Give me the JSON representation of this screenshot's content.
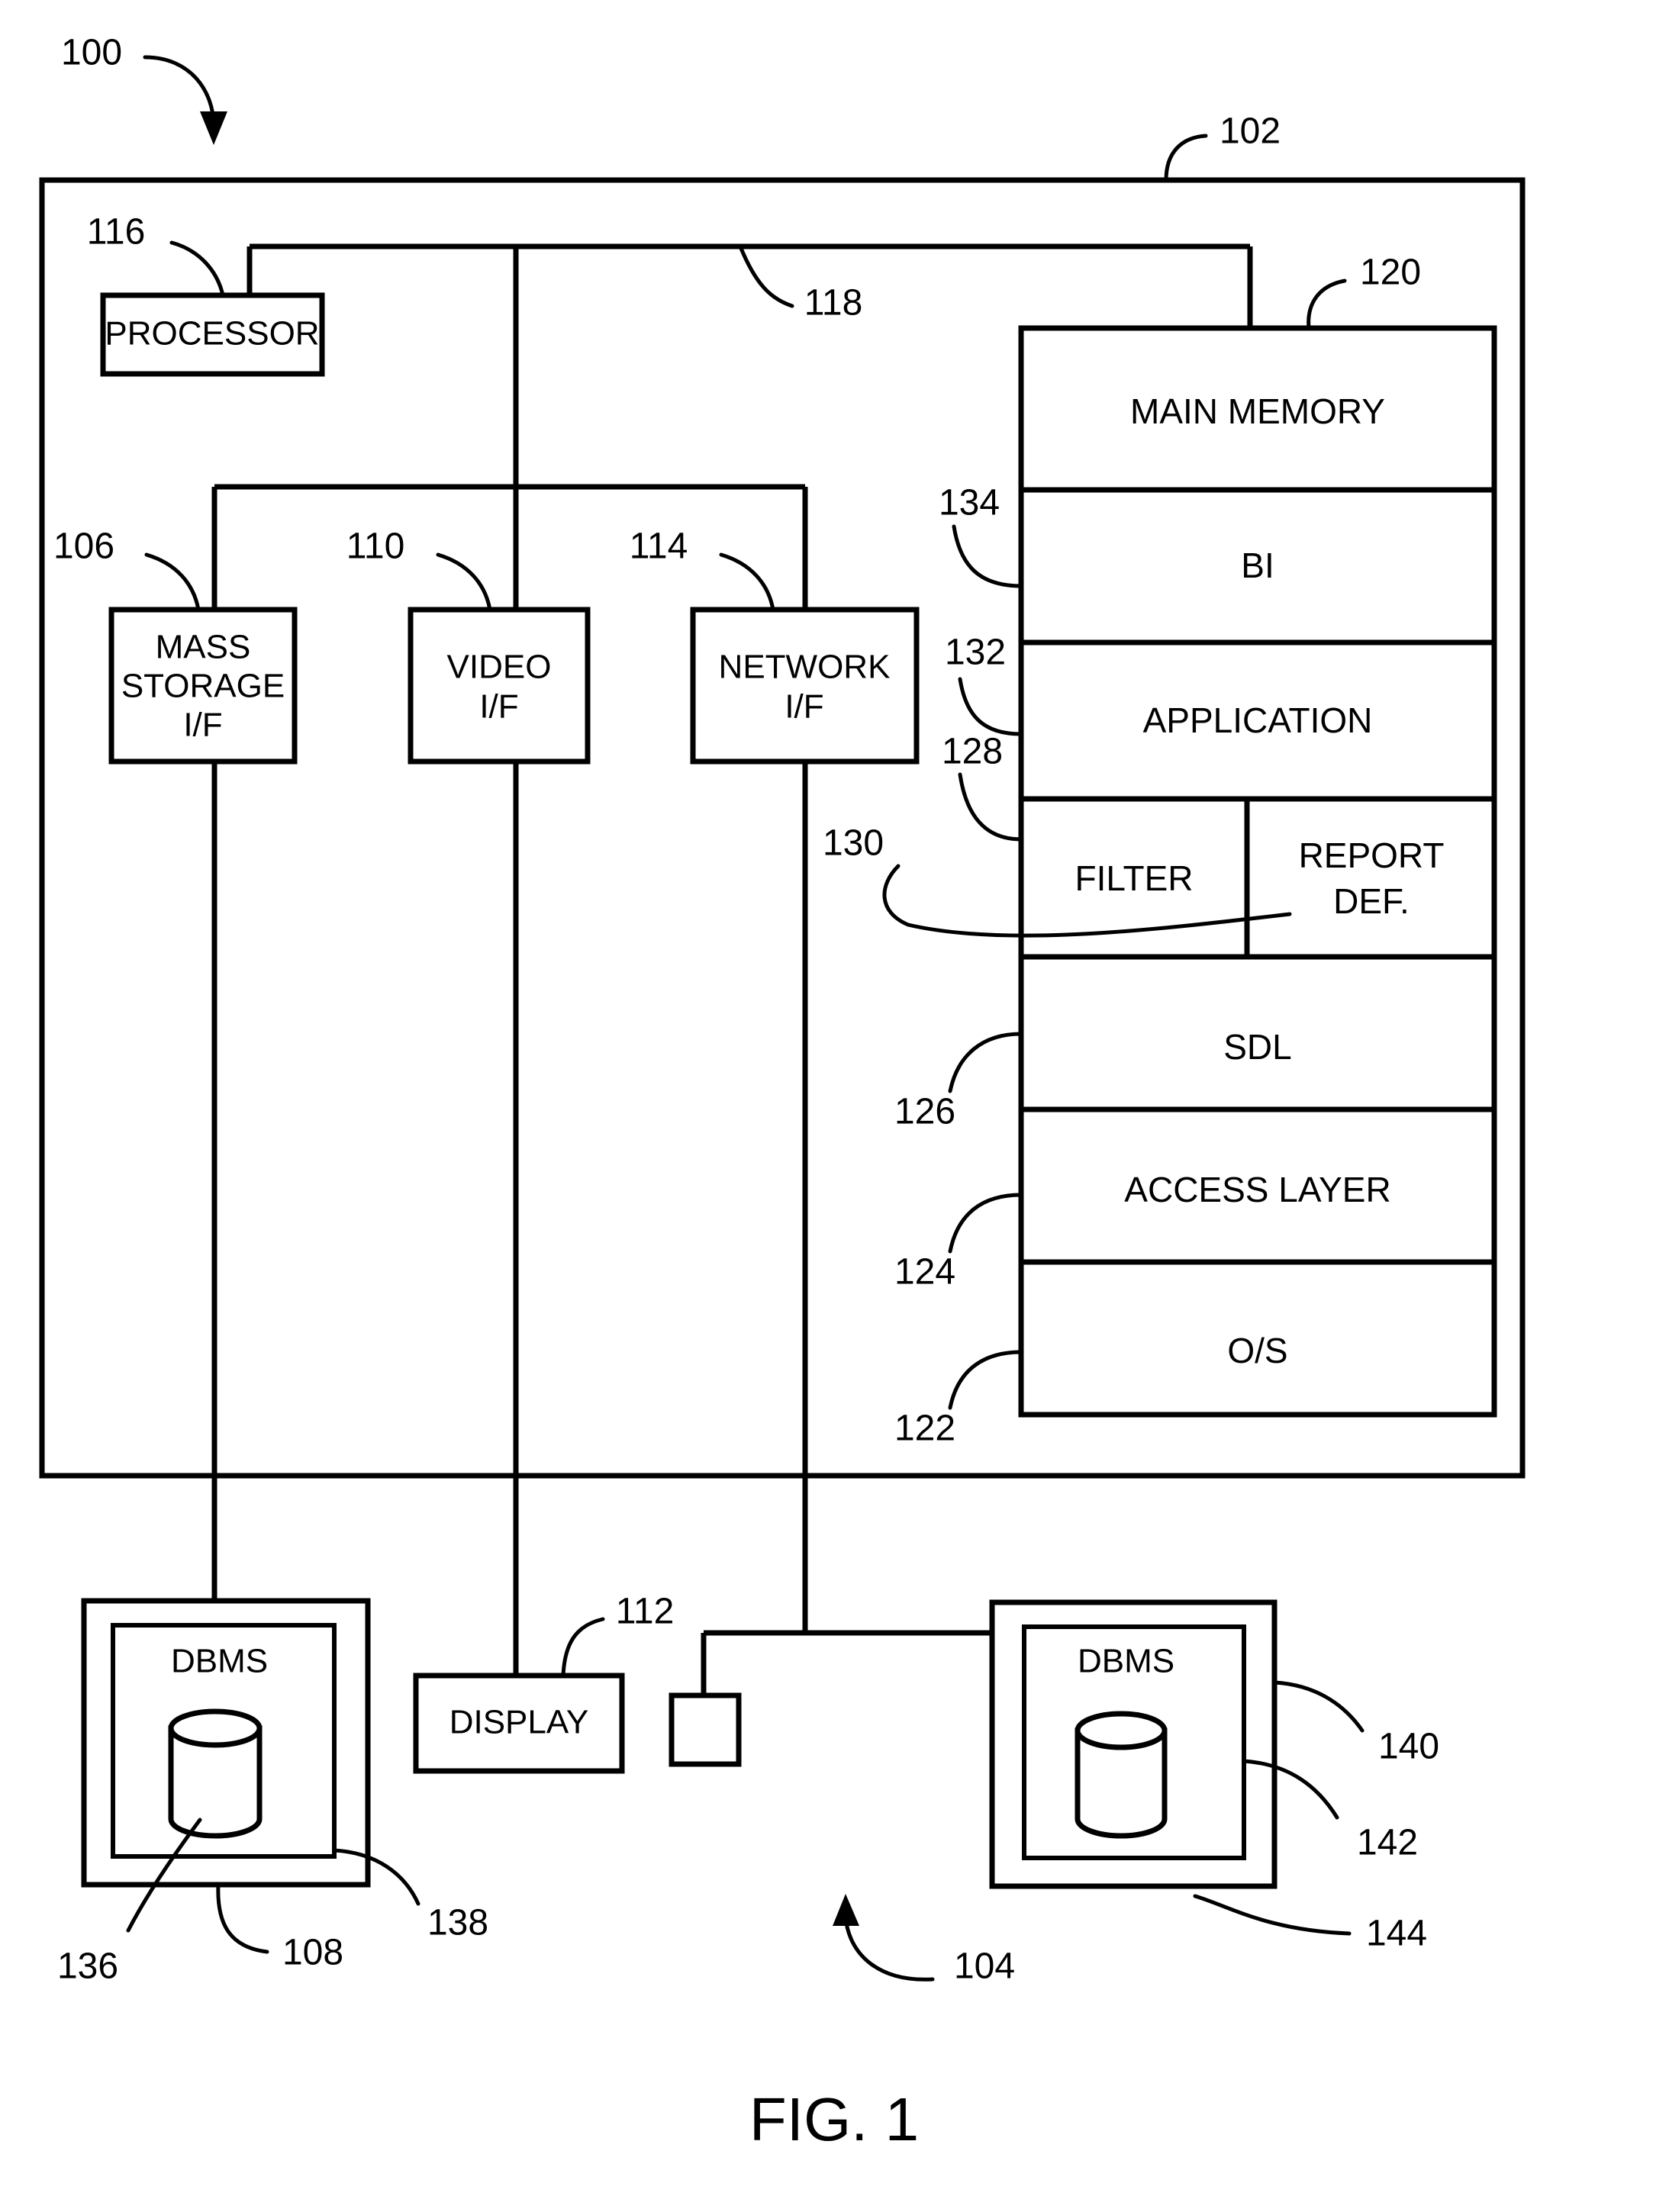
{
  "figure": {
    "caption": "FIG. 1",
    "reference_numerals": {
      "system": "100",
      "computer_system": "102",
      "remote_system": "104",
      "mass_storage_if": "106",
      "local_storage": "108",
      "video_if": "110",
      "display": "112",
      "network_if": "114",
      "processor": "116",
      "bus": "118",
      "main_memory": "120",
      "os": "122",
      "access_layer": "124",
      "sdl": "126",
      "filter": "128",
      "report_def": "130",
      "application": "132",
      "bi": "134",
      "database_local": "136",
      "dbms_local_inner": "138",
      "dbms_remote_outer": "140",
      "dbms_remote_inner": "142",
      "database_remote": "144"
    }
  },
  "blocks": {
    "processor": "PROCESSOR",
    "mass_storage_if_line1": "MASS",
    "mass_storage_if_line2": "STORAGE",
    "mass_storage_if_line3": "I/F",
    "video_if_line1": "VIDEO",
    "video_if_line2": "I/F",
    "network_if_line1": "NETWORK",
    "network_if_line2": "I/F",
    "display": "DISPLAY",
    "dbms_local": "DBMS",
    "dbms_remote": "DBMS"
  },
  "memory_stack": {
    "title": "MAIN MEMORY",
    "layers": [
      {
        "label": "BI",
        "ref": "134"
      },
      {
        "label": "APPLICATION",
        "ref": "132"
      },
      {
        "label": "SDL",
        "ref": "126"
      },
      {
        "label": "ACCESS LAYER",
        "ref": "124"
      },
      {
        "label": "O/S",
        "ref": "122"
      }
    ],
    "split_row": {
      "left_label": "FILTER",
      "left_ref": "128",
      "right_label_line1": "REPORT",
      "right_label_line2": "DEF.",
      "right_ref": "130"
    }
  },
  "colors": {
    "ink": "#000000",
    "paper": "#ffffff"
  }
}
